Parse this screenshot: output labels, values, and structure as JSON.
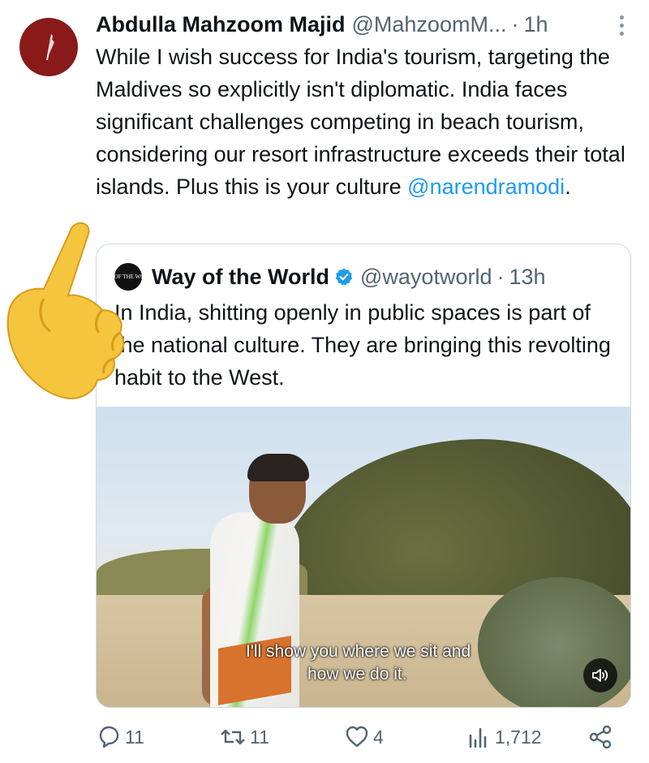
{
  "tweet": {
    "author_name": "Abdulla Mahzoom Majid",
    "author_handle": "@MahzoomM...",
    "separator": "·",
    "time": "1h",
    "text": "While I wish success for India's tourism, targeting the Maldives so explicitly isn't diplomatic. India faces significant challenges competing in beach tourism, considering our resort infrastructure exceeds their total islands. Plus this is your culture ",
    "mention": "@narendramodi",
    "text_end": "."
  },
  "quote": {
    "avatar_text": "WAY OF THE WORLD",
    "author_name": "Way of the World",
    "author_handle": "@wayotworld",
    "separator": "·",
    "time": "13h",
    "text": "In India, shitting openly in public spaces is part of the national culture. They are bringing this revolting habit to the West.",
    "video": {
      "subtitle_line1": "I'll show you where we sit and",
      "subtitle_line2": "how we do it."
    }
  },
  "actions": {
    "replies": "11",
    "reposts": "11",
    "likes": "4",
    "views": "1,712"
  },
  "colors": {
    "accent": "#1d9bf0",
    "secondary_text": "#536471",
    "avatar_bg": "#8a1a1a"
  },
  "icons": [
    "more-icon",
    "verified-icon",
    "sound-icon",
    "reply-icon",
    "repost-icon",
    "like-icon",
    "views-icon",
    "share-icon"
  ]
}
